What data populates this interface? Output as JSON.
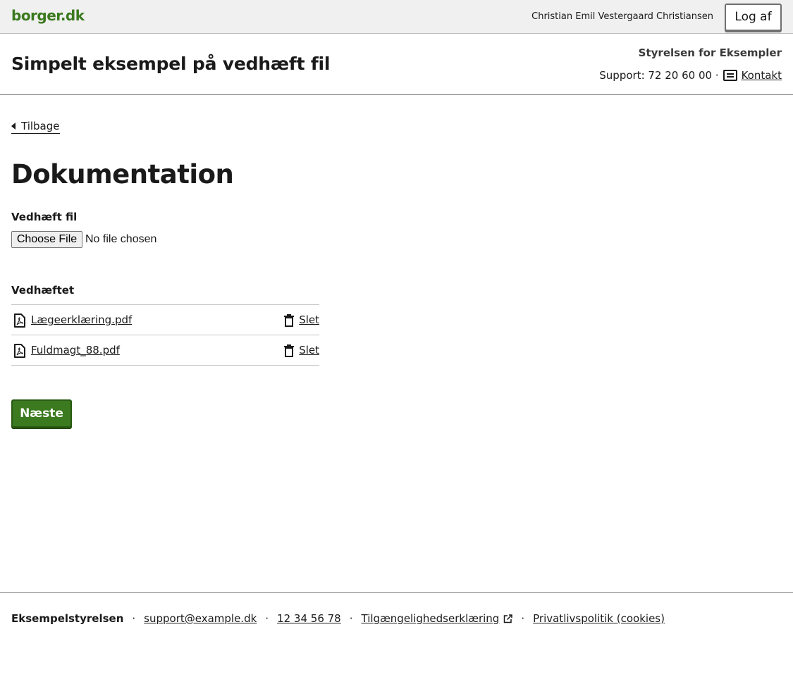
{
  "topbar": {
    "logo": "borger.dk",
    "username": "Christian Emil Vestergaard Christiansen",
    "logout_label": "Log af"
  },
  "header": {
    "title": "Simpelt eksempel på vedhæft fil",
    "authority": "Styrelsen for Eksempler",
    "support_text": "Support: 72 20 60 00 ·",
    "contact_label": "Kontakt"
  },
  "main": {
    "back_label": "Tilbage",
    "heading": "Dokumentation",
    "file_field": {
      "label": "Vedhæft fil",
      "button_label": "Choose File",
      "status": "No file chosen"
    },
    "attached": {
      "heading": "Vedhæftet",
      "files": [
        {
          "name": "Lægeerklæring.pdf",
          "delete_label": "Slet",
          "icon": "pdf-file-icon"
        },
        {
          "name": "Fuldmagt_88.pdf",
          "delete_label": "Slet",
          "icon": "pdf-file-icon"
        }
      ]
    },
    "next_label": "Næste"
  },
  "footer": {
    "org": "Eksempelstyrelsen",
    "email": "support@example.dk",
    "phone": "12 34 56 78",
    "accessibility": "Tilgængelighedserklæring",
    "privacy": "Privatlivspolitik (cookies)",
    "separator": "·"
  },
  "colors": {
    "brand_green": "#3b7a1f",
    "topbar_bg": "#f0f0f0",
    "text": "#1a1a1a"
  }
}
